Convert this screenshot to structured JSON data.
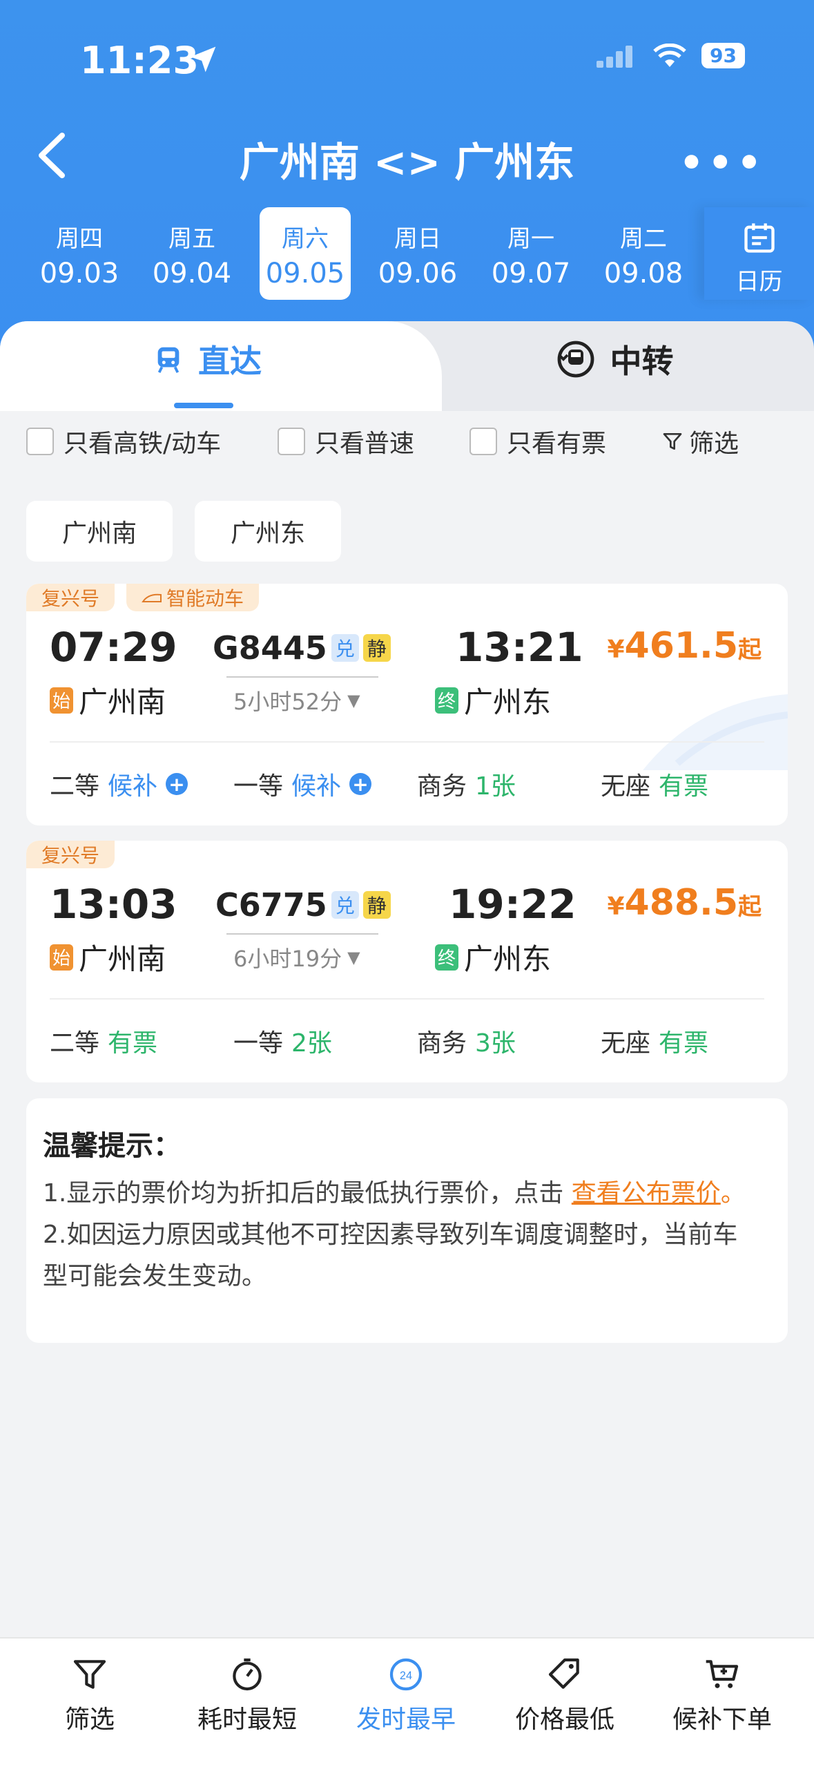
{
  "status_bar": {
    "time": "11:23",
    "battery": "93"
  },
  "nav": {
    "title": "广州南 <> 广州东"
  },
  "dates": [
    {
      "weekday": "周四",
      "date": "09.03"
    },
    {
      "weekday": "周五",
      "date": "09.04"
    },
    {
      "weekday": "周六",
      "date": "09.05"
    },
    {
      "weekday": "周日",
      "date": "09.06"
    },
    {
      "weekday": "周一",
      "date": "09.07"
    },
    {
      "weekday": "周二",
      "date": "09.08"
    }
  ],
  "calendar_label": "日历",
  "tabs": {
    "direct": "直达",
    "transfer": "中转"
  },
  "filters": {
    "high_speed": "只看高铁/动车",
    "normal": "只看普速",
    "available": "只看有票",
    "screen": "筛选"
  },
  "station_chips": [
    "广州南",
    "广州东"
  ],
  "trains": [
    {
      "tags": [
        "复兴号",
        "智能动车"
      ],
      "dep_time": "07:29",
      "arr_time": "13:21",
      "train_no": "G8445",
      "badge1": "兑",
      "badge2": "静",
      "duration": "5小时52分",
      "dep_station": "广州南",
      "arr_station": "广州东",
      "dep_tag": "始",
      "arr_tag": "终",
      "price_symbol": "¥",
      "price": "461.5",
      "price_suffix": "起",
      "seats": [
        {
          "class": "二等",
          "avail": "候补"
        },
        {
          "class": "一等",
          "avail": "候补"
        },
        {
          "class": "商务",
          "avail": "1张"
        },
        {
          "class": "无座",
          "avail": "有票"
        }
      ]
    },
    {
      "tags": [
        "复兴号"
      ],
      "dep_time": "13:03",
      "arr_time": "19:22",
      "train_no": "C6775",
      "badge1": "兑",
      "badge2": "静",
      "duration": "6小时19分",
      "dep_station": "广州南",
      "arr_station": "广州东",
      "dep_tag": "始",
      "arr_tag": "终",
      "price_symbol": "¥",
      "price": "488.5",
      "price_suffix": "起",
      "seats": [
        {
          "class": "二等",
          "avail": "有票"
        },
        {
          "class": "一等",
          "avail": "2张"
        },
        {
          "class": "商务",
          "avail": "3张"
        },
        {
          "class": "无座",
          "avail": "有票"
        }
      ]
    }
  ],
  "tips": {
    "title": "温馨提示：",
    "line1_prefix": "1.显示的票价均为折扣后的最低执行票价，点击 ",
    "line1_link": "查看公布票价",
    "line1_suffix": "。",
    "line2a": "2.如因运力原因或其他不可控因素导致列车调度调整时，当前车",
    "line2b": "型可能会发生变动。"
  },
  "bottom_bar": [
    {
      "label": "筛选",
      "icon": "filter-icon"
    },
    {
      "label": "耗时最短",
      "icon": "stopwatch-icon"
    },
    {
      "label": "发时最早",
      "icon": "clock-24-icon"
    },
    {
      "label": "价格最低",
      "icon": "price-tag-icon"
    },
    {
      "label": "候补下单",
      "icon": "cart-icon"
    }
  ],
  "colors": {
    "primary": "#3b8ff0",
    "price": "#f07e1e",
    "available": "#2db56b"
  }
}
